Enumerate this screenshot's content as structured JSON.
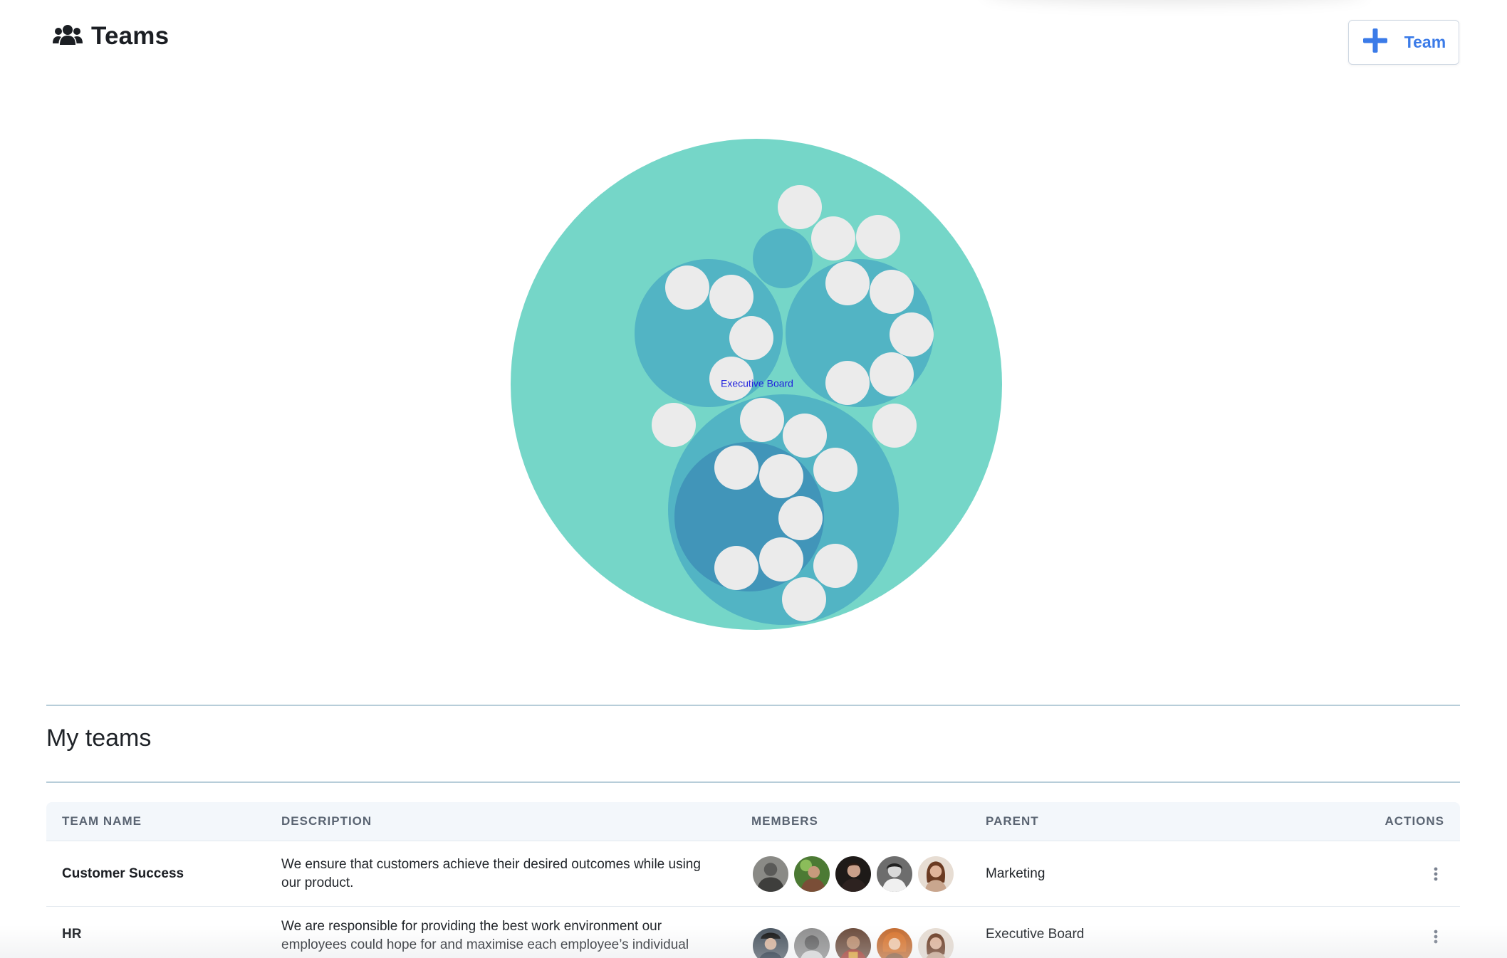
{
  "header": {
    "title": "Teams",
    "title_icon": "users-icon",
    "add_button": {
      "icon": "plus-icon",
      "label": "Team"
    }
  },
  "chart_data": {
    "type": "circle-packing",
    "root": "Executive Board",
    "label": "Executive Board",
    "colors": {
      "root": "#75d6c8",
      "team": "#52b4c4",
      "subteam": "#4195b9",
      "member": "#ebebeb",
      "label": "#2222dd"
    }
  },
  "section": {
    "title": "My teams"
  },
  "table": {
    "columns": [
      "Team name",
      "Description",
      "Members",
      "Parent",
      "Actions"
    ],
    "rows": [
      {
        "name": "Customer Success",
        "description": "We ensure that customers achieve their desired outcomes while using our product.",
        "parent": "Marketing",
        "member_count_shown": 5,
        "actions_icon": "more-vertical-icon"
      },
      {
        "name": "HR",
        "description": "We are responsible for providing the best work environment our employees could hope for and maximise each employee’s individual",
        "parent": "Executive Board",
        "member_count_shown": 5,
        "actions_icon": "more-vertical-icon"
      }
    ]
  }
}
